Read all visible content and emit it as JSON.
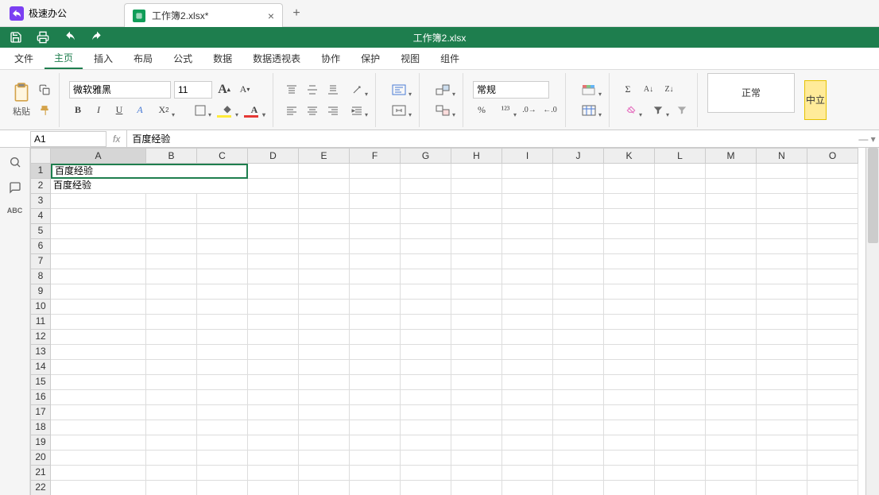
{
  "app": {
    "name": "极速办公"
  },
  "tab": {
    "title": "工作簿2.xlsx*"
  },
  "menubar": {
    "doc_title": "工作簿2.xlsx"
  },
  "ribbon_tabs": [
    "文件",
    "主页",
    "插入",
    "布局",
    "公式",
    "数据",
    "数据透视表",
    "协作",
    "保护",
    "视图",
    "组件"
  ],
  "ribbon_active": 1,
  "clipboard": {
    "paste_label": "粘贴"
  },
  "font": {
    "name": "微软雅黑",
    "size": "11"
  },
  "number": {
    "format": "常规"
  },
  "style": {
    "normal": "正常",
    "cn": "中立"
  },
  "namebox": "A1",
  "formula": "百度经验",
  "columns": [
    "A",
    "B",
    "C",
    "D",
    "E",
    "F",
    "G",
    "H",
    "I",
    "J",
    "K",
    "L",
    "M",
    "N",
    "O"
  ],
  "rows": 22,
  "cells": {
    "A1": "百度经验",
    "A2": "百度经验"
  },
  "active_cell": "A1",
  "merged_row1": true,
  "sidebar_abc": "ABC"
}
